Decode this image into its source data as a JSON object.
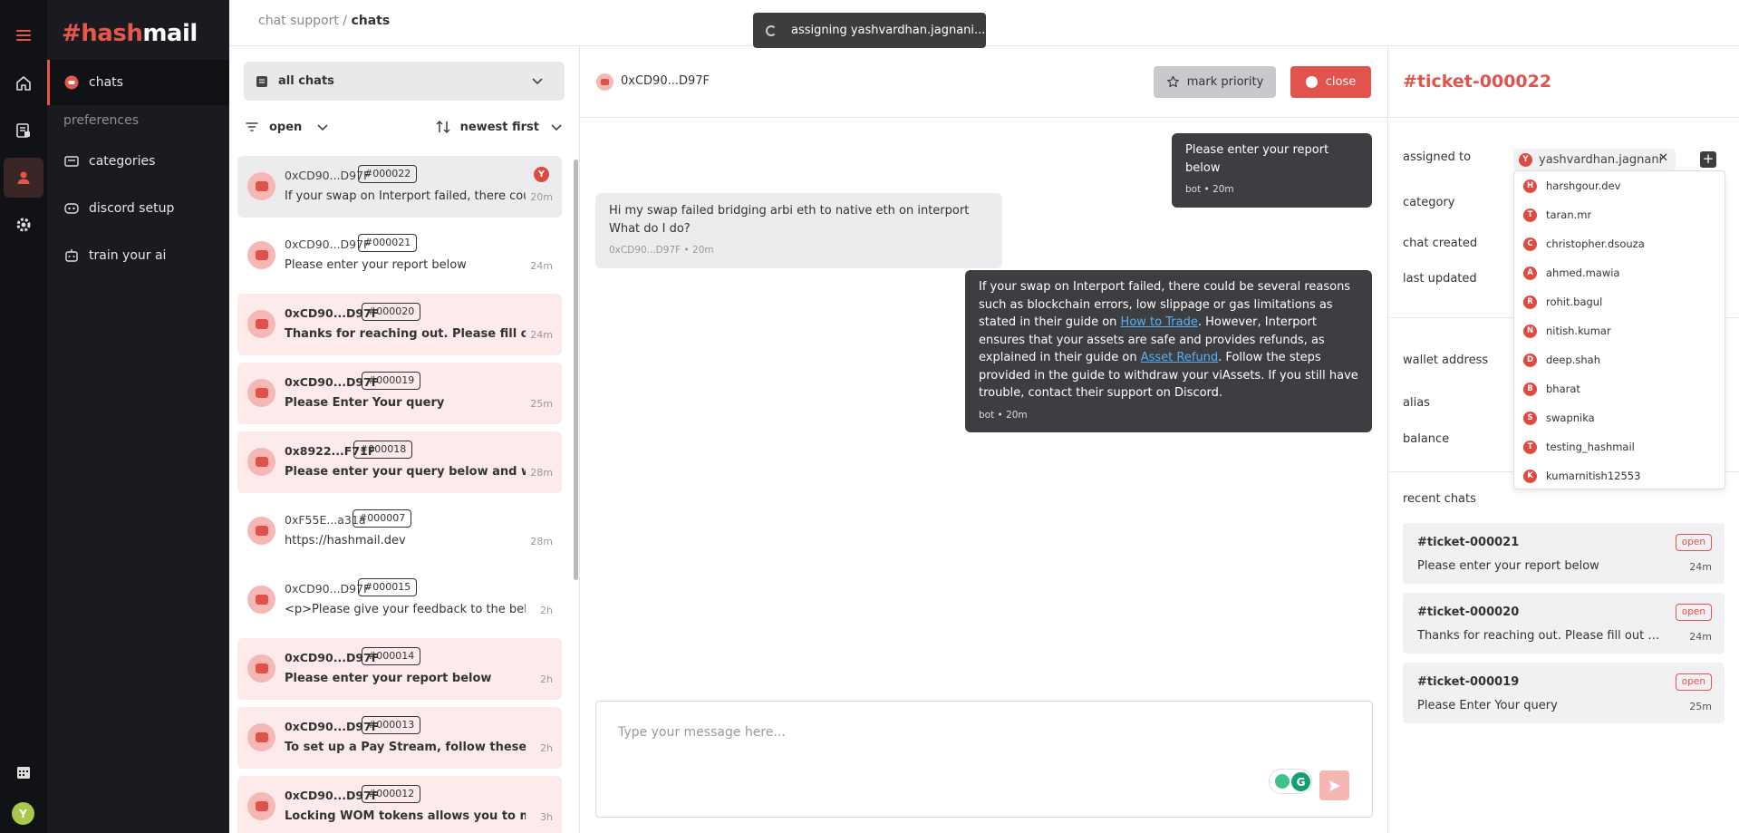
{
  "brand": {
    "hash": "#hash",
    "mail": "mail"
  },
  "nav": {
    "chats": "chats",
    "preferences": "preferences",
    "categories": "categories",
    "discord_setup": "discord setup",
    "train_ai": "train your ai"
  },
  "user": {
    "initial": "Y"
  },
  "breadcrumb": {
    "parent": "chat support",
    "sep": " / ",
    "current": "chats"
  },
  "toast": {
    "text": "assigning yashvardhan.jagnani..."
  },
  "chat_list": {
    "filter": "all chats",
    "status": "open",
    "sort": "newest first",
    "items": [
      {
        "who": "0xCD90...D97F",
        "ticket": "#000022",
        "msg": "If your swap on Interport failed, there could b",
        "time": "20m",
        "assignee": "Y"
      },
      {
        "who": "0xCD90...D97F",
        "ticket": "#000021",
        "msg": "Please enter your report below",
        "time": "24m"
      },
      {
        "who": "0xCD90...D97F",
        "ticket": "#000020",
        "msg": "Thanks for reaching out. Please fill out this p",
        "time": "24m"
      },
      {
        "who": "0xCD90...D97F",
        "ticket": "#000019",
        "msg": "Please Enter Your query",
        "time": "25m"
      },
      {
        "who": "0x8922...F71F",
        "ticket": "#000018",
        "msg": "Please enter your query below and we'll get",
        "time": "28m"
      },
      {
        "who": "0xF55E...a31a",
        "ticket": "#000007",
        "msg": "https://hashmail.dev",
        "time": "28m"
      },
      {
        "who": "0xCD90...D97F",
        "ticket": "#000015",
        "msg": "<p>Please give your feedback to the below link",
        "time": "2h"
      },
      {
        "who": "0xCD90...D97F",
        "ticket": "#000014",
        "msg": "Please enter your report below",
        "time": "2h"
      },
      {
        "who": "0xCD90...D97F",
        "ticket": "#000013",
        "msg": "To set up a Pay Stream, follow these steps:...",
        "time": "2h"
      },
      {
        "who": "0xCD90...D97F",
        "ticket": "#000012",
        "msg": "Locking WOM tokens allows you to mint ve",
        "time": "3h"
      }
    ]
  },
  "conversation": {
    "header_name": "0xCD90...D97F",
    "mark_priority": "mark priority",
    "close": "close",
    "messages": [
      {
        "text": "Please enter your report below",
        "meta": "bot • 20m"
      },
      {
        "text": "Hi my swap failed bridging arbi eth to native eth on interport What do I do?",
        "meta": "0xCD90...D97F • 20m"
      },
      {
        "p1": "If your swap on Interport failed, there could be several reasons such as blockchain errors, low slippage or gas limitations as stated in their guide on ",
        "link1": "How to Trade",
        "p2": ". However, Interport ensures that your assets are safe and provides refunds, as explained in their guide on ",
        "link2": "Asset Refund",
        "p3": ". Follow the steps provided in the guide to withdraw your viAssets. If you still have trouble, contact their support on Discord.",
        "meta": "bot • 20m"
      }
    ],
    "composer_placeholder": "Type your message here..."
  },
  "details": {
    "title": "#ticket-000022",
    "labels": {
      "assigned_to": "assigned to",
      "category": "category",
      "chat_created": "chat created",
      "last_updated": "last updated",
      "wallet_address": "wallet address",
      "alias": "alias",
      "balance": "balance"
    },
    "assignee": {
      "initial": "Y",
      "name": "yashvardhan.jagnani"
    },
    "agents": [
      {
        "initial": "H",
        "name": "harshgour.dev"
      },
      {
        "initial": "T",
        "name": "taran.mr"
      },
      {
        "initial": "C",
        "name": "christopher.dsouza"
      },
      {
        "initial": "A",
        "name": "ahmed.mawia"
      },
      {
        "initial": "R",
        "name": "rohit.bagul"
      },
      {
        "initial": "N",
        "name": "nitish.kumar"
      },
      {
        "initial": "D",
        "name": "deep.shah"
      },
      {
        "initial": "B",
        "name": "bharat"
      },
      {
        "initial": "S",
        "name": "swapnika"
      },
      {
        "initial": "T",
        "name": "testing_hashmail"
      },
      {
        "initial": "K",
        "name": "kumarnitish12553"
      }
    ],
    "recent_chats_label": "recent chats",
    "recent": [
      {
        "id": "#ticket-000021",
        "status": "open",
        "text": "Please enter your report below",
        "time": "24m"
      },
      {
        "id": "#ticket-000020",
        "status": "open",
        "text": "Thanks for reaching out. Please fill out this [part...",
        "time": "24m"
      },
      {
        "id": "#ticket-000019",
        "status": "open",
        "text": "Please Enter Your query",
        "time": "25m"
      }
    ]
  },
  "colors": {
    "accent": "#e0544c",
    "sidebar": "#1a1b20",
    "rail": "#111216"
  }
}
